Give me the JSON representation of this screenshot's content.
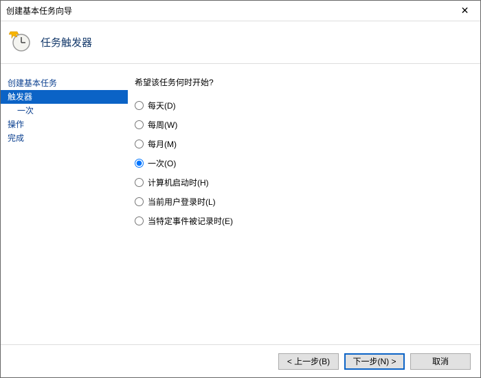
{
  "window": {
    "title": "创建基本任务向导"
  },
  "header": {
    "heading": "任务触发器"
  },
  "sidebar": {
    "items": [
      {
        "label": "创建基本任务",
        "selected": false
      },
      {
        "label": "触发器",
        "selected": true
      },
      {
        "label": "操作",
        "selected": false
      },
      {
        "label": "完成",
        "selected": false
      }
    ],
    "subitem": "一次"
  },
  "main": {
    "prompt": "希望该任务何时开始?",
    "options": [
      {
        "label": "每天(D)",
        "value": "daily",
        "checked": false
      },
      {
        "label": "每周(W)",
        "value": "weekly",
        "checked": false
      },
      {
        "label": "每月(M)",
        "value": "monthly",
        "checked": false
      },
      {
        "label": "一次(O)",
        "value": "once",
        "checked": true
      },
      {
        "label": "计算机启动时(H)",
        "value": "startup",
        "checked": false
      },
      {
        "label": "当前用户登录时(L)",
        "value": "logon",
        "checked": false
      },
      {
        "label": "当特定事件被记录时(E)",
        "value": "event",
        "checked": false
      }
    ]
  },
  "footer": {
    "back": "< 上一步(B)",
    "next": "下一步(N) >",
    "cancel": "取消"
  }
}
